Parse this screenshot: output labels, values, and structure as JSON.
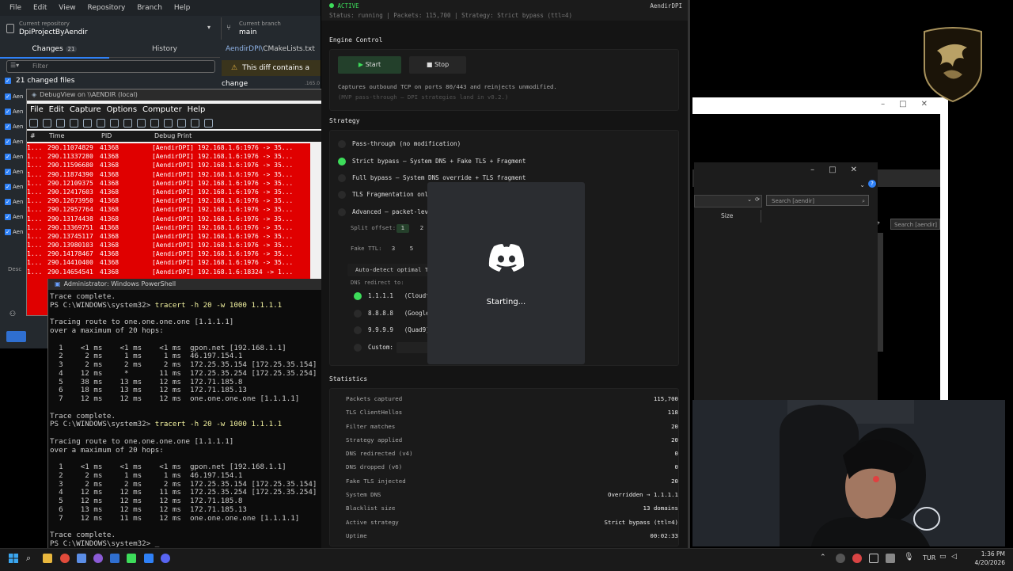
{
  "github": {
    "menu": [
      "File",
      "Edit",
      "View",
      "Repository",
      "Branch",
      "Help"
    ],
    "current_repository_label": "Current repository",
    "repository": "DpiProjectByAendir",
    "current_branch_label": "Current branch",
    "branch": "main",
    "tab_changes": "Changes",
    "changes_count": "21",
    "tab_history": "History",
    "filter_placeholder": "Filter",
    "changed_files": "21 changed files",
    "diff_file_prefix": "AendirDPI\\",
    "diff_file_name": "CMakeLists.txt",
    "diff_warning": "This diff contains a change",
    "file_stub": "Aen",
    "description_stub": "Desc",
    "diff_line_hint": ".165.0"
  },
  "debugview": {
    "title": "DebugView on \\\\AENDIR (local)",
    "menu": [
      "File",
      "Edit",
      "Capture",
      "Options",
      "Computer",
      "Help"
    ],
    "columns": [
      "#",
      "Time",
      "PID",
      "Debug Print"
    ],
    "rows": [
      {
        "num": "1...",
        "time": "290.11074829",
        "pid": "41368",
        "msg": "[AendirDPI] 192.168.1.6:1976 -> 35..."
      },
      {
        "num": "1...",
        "time": "290.11337280",
        "pid": "41368",
        "msg": "[AendirDPI] 192.168.1.6:1976 -> 35..."
      },
      {
        "num": "1...",
        "time": "290.11596680",
        "pid": "41368",
        "msg": "[AendirDPI] 192.168.1.6:1976 -> 35..."
      },
      {
        "num": "1...",
        "time": "290.11874390",
        "pid": "41368",
        "msg": "[AendirDPI] 192.168.1.6:1976 -> 35..."
      },
      {
        "num": "1...",
        "time": "290.12109375",
        "pid": "41368",
        "msg": "[AendirDPI] 192.168.1.6:1976 -> 35..."
      },
      {
        "num": "1...",
        "time": "290.12417603",
        "pid": "41368",
        "msg": "[AendirDPI] 192.168.1.6:1976 -> 35..."
      },
      {
        "num": "1...",
        "time": "290.12673950",
        "pid": "41368",
        "msg": "[AendirDPI] 192.168.1.6:1976 -> 35..."
      },
      {
        "num": "1...",
        "time": "290.12957764",
        "pid": "41368",
        "msg": "[AendirDPI] 192.168.1.6:1976 -> 35..."
      },
      {
        "num": "1...",
        "time": "290.13174438",
        "pid": "41368",
        "msg": "[AendirDPI] 192.168.1.6:1976 -> 35..."
      },
      {
        "num": "1...",
        "time": "290.13369751",
        "pid": "41368",
        "msg": "[AendirDPI] 192.168.1.6:1976 -> 35..."
      },
      {
        "num": "1...",
        "time": "290.13745117",
        "pid": "41368",
        "msg": "[AendirDPI] 192.168.1.6:1976 -> 35..."
      },
      {
        "num": "1...",
        "time": "290.13980103",
        "pid": "41368",
        "msg": "[AendirDPI] 192.168.1.6:1976 -> 35..."
      },
      {
        "num": "1...",
        "time": "290.14178467",
        "pid": "41368",
        "msg": "[AendirDPI] 192.168.1.6:1976 -> 35..."
      },
      {
        "num": "1...",
        "time": "290.14410400",
        "pid": "41368",
        "msg": "[AendirDPI] 192.168.1.6:1976 -> 35..."
      },
      {
        "num": "1...",
        "time": "290.14654541",
        "pid": "41368",
        "msg": "[AendirDPI] 192.168.1.6:18324 -> 1..."
      }
    ]
  },
  "powershell": {
    "title": "Administrator: Windows PowerShell",
    "prompt": "PS C:\\WINDOWS\\system32>",
    "command": "tracert -h 20 -w 1000 1.1.1.1",
    "lines_a": [
      "Trace complete."
    ],
    "block1": [
      "Tracing route to one.one.one.one [1.1.1.1]",
      "over a maximum of 20 hops:",
      "",
      "  1    <1 ms    <1 ms    <1 ms  gpon.net [192.168.1.1]",
      "  2     2 ms     1 ms     1 ms  46.197.154.1",
      "  3     2 ms     2 ms     2 ms  172.25.35.154 [172.25.35.154]",
      "  4    12 ms     *       11 ms  172.25.35.254 [172.25.35.254]",
      "  5    38 ms    13 ms    12 ms  172.71.185.8",
      "  6    18 ms    13 ms    12 ms  172.71.185.13",
      "  7    12 ms    12 ms    12 ms  one.one.one.one [1.1.1.1]",
      "",
      "Trace complete."
    ],
    "block2": [
      "Tracing route to one.one.one.one [1.1.1.1]",
      "over a maximum of 20 hops:",
      "",
      "  1    <1 ms    <1 ms    <1 ms  gpon.net [192.168.1.1]",
      "  2     2 ms     1 ms     1 ms  46.197.154.1",
      "  3     2 ms     2 ms     2 ms  172.25.35.154 [172.25.35.154]",
      "  4    12 ms    12 ms    11 ms  172.25.35.254 [172.25.35.254]",
      "  5    12 ms    12 ms    12 ms  172.71.185.8",
      "  6    13 ms    12 ms    12 ms  172.71.185.13",
      "  7    12 ms    11 ms    12 ms  one.one.one.one [1.1.1.1]",
      "",
      "Trace complete."
    ]
  },
  "dpi": {
    "status": "ACTIVE",
    "app_name": "AendirDPI",
    "status_line": "Status: running  |  Packets: 115,700  |  Strategy: Strict bypass (ttl=4)",
    "engine_title": "Engine Control",
    "start": "Start",
    "stop": "Stop",
    "capture_note": "Captures outbound TCP on ports 80/443 and reinjects unmodified.",
    "mvp_note": "(MVP pass-through — DPI strategies land in v0.2.)",
    "strategy_title": "Strategy",
    "strategies": [
      "Pass-through (no modification)",
      "Strict bypass  — System DNS + Fake TLS + Fragment",
      "Full bypass  — System DNS override + TLS fragment",
      "TLS Fragmentation only",
      "Advanced  — packet-leve"
    ],
    "split_offset_label": "Split offset:",
    "split_offsets": [
      "1",
      "2"
    ],
    "fake_ttl_label": "Fake TTL:",
    "fake_ttls": [
      "3",
      "5",
      "7"
    ],
    "auto_detect": "Auto-detect optimal TTL",
    "dns_redirect_label": "DNS redirect to:",
    "dns_options": [
      {
        "ip": "1.1.1.1",
        "name": "(Cloudfla"
      },
      {
        "ip": "8.8.8.8",
        "name": "(Google)"
      },
      {
        "ip": "9.9.9.9",
        "name": "(Quad9)"
      }
    ],
    "custom_label": "Custom:",
    "stats_title": "Statistics",
    "stats": [
      {
        "k": "Packets captured",
        "v": "115,700"
      },
      {
        "k": "TLS ClientHellos",
        "v": "118"
      },
      {
        "k": "Filter matches",
        "v": "20"
      },
      {
        "k": "Strategy applied",
        "v": "20"
      },
      {
        "k": "DNS redirected (v4)",
        "v": "0"
      },
      {
        "k": "DNS dropped (v6)",
        "v": "0"
      },
      {
        "k": "Fake TLS injected",
        "v": "20"
      },
      {
        "k": "System DNS",
        "v": "Overridden → 1.1.1.1"
      },
      {
        "k": "Blacklist size",
        "v": "13 domains"
      },
      {
        "k": "Active strategy",
        "v": "Strict bypass (ttl=4)"
      },
      {
        "k": "Uptime",
        "v": "00:02:33"
      }
    ]
  },
  "discord": {
    "status": "Starting..."
  },
  "explorer": {
    "search1": "Search [aendir]",
    "search2": "Search [aendir]",
    "col_size": "Size"
  },
  "taskbar": {
    "lang": "TUR",
    "time": "1:36 PM",
    "date": "4/20/2026"
  },
  "colors": {
    "accent_green": "#3ddc5a",
    "debug_red": "#e00000",
    "github_blue": "#2f81f7"
  }
}
